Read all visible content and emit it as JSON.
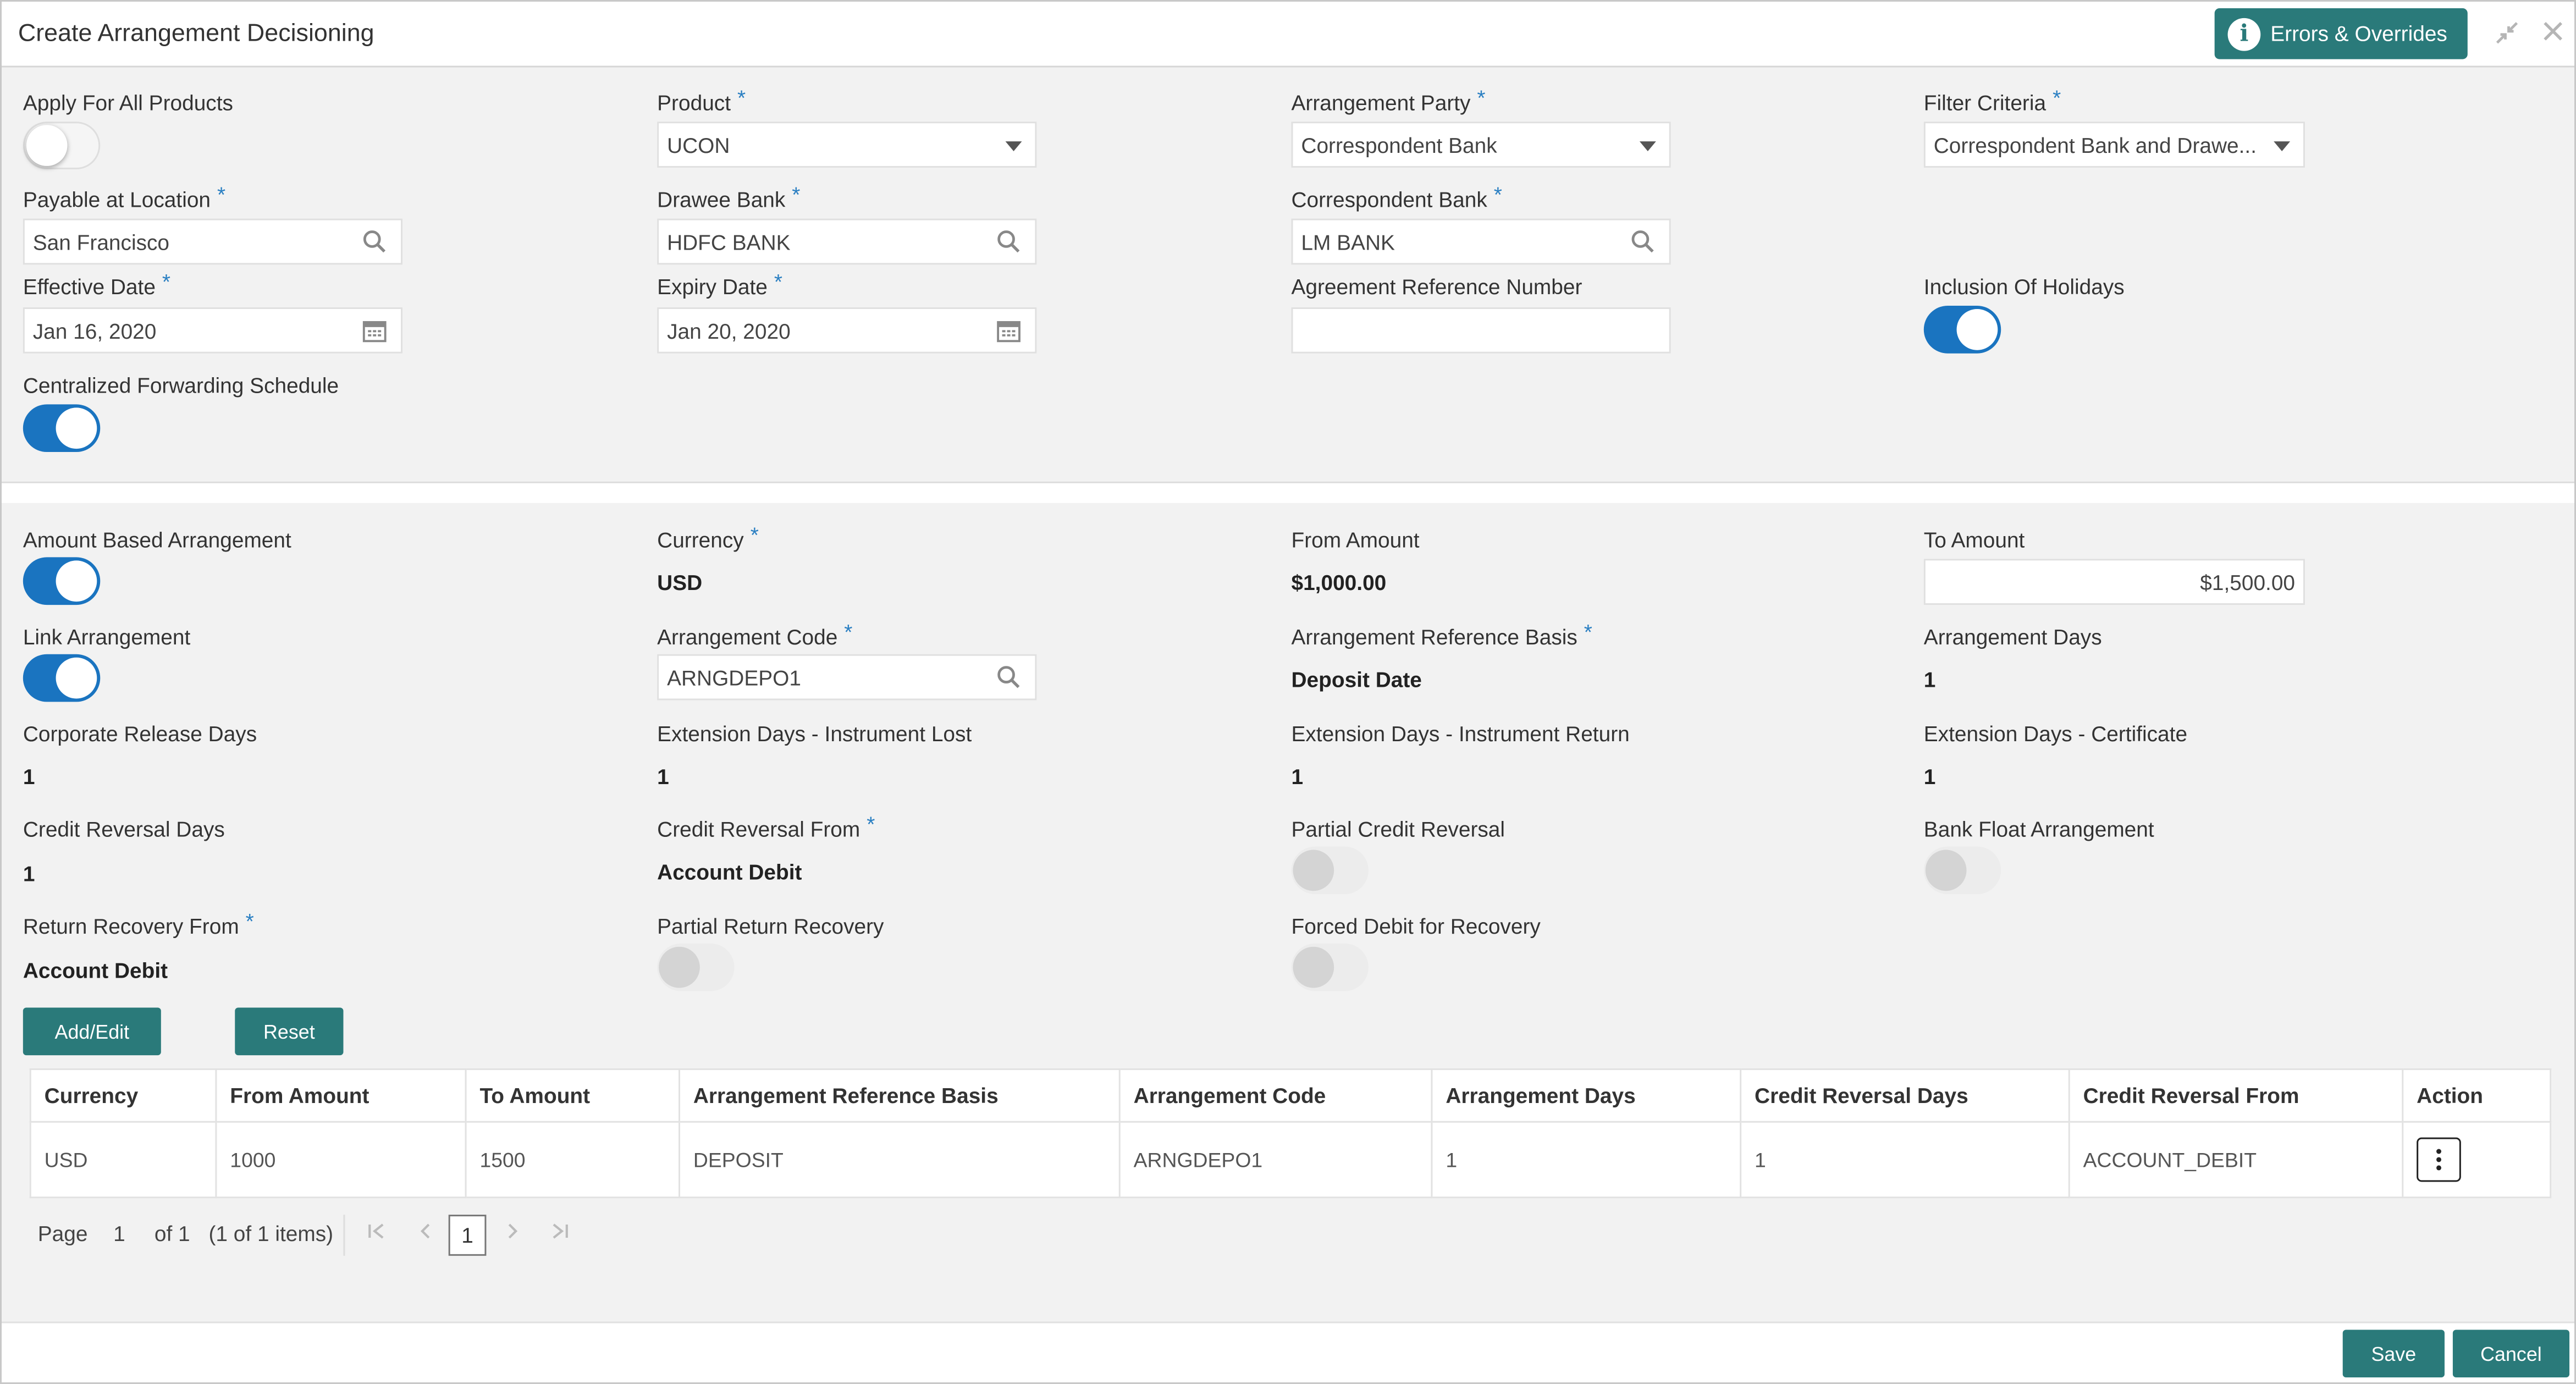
{
  "window": {
    "title": "Create Arrangement Decisioning",
    "errors_button": "Errors & Overrides",
    "info_icon": "i"
  },
  "section1": {
    "apply_all_label": "Apply For All Products",
    "apply_all_state": "off",
    "product_label": "Product",
    "product_value": "UCON",
    "arrangement_party_label": "Arrangement Party",
    "arrangement_party_value": "Correspondent Bank",
    "filter_criteria_label": "Filter Criteria",
    "filter_criteria_value": "Correspondent Bank and Drawe...",
    "payable_label": "Payable at Location",
    "payable_value": "San Francisco",
    "drawee_label": "Drawee Bank",
    "drawee_value": "HDFC BANK",
    "correspondent_label": "Correspondent Bank",
    "correspondent_value": "LM BANK",
    "effective_label": "Effective Date",
    "effective_value": "Jan 16, 2020",
    "expiry_label": "Expiry Date",
    "expiry_value": "Jan 20, 2020",
    "agreement_label": "Agreement Reference Number",
    "agreement_value": "",
    "holidays_label": "Inclusion Of Holidays",
    "holidays_state": "on",
    "cfs_label": "Centralized Forwarding Schedule",
    "cfs_state": "on"
  },
  "section2": {
    "amount_based_label": "Amount Based Arrangement",
    "currency_label": "Currency",
    "currency_value": "USD",
    "from_amount_label": "From Amount",
    "from_amount_value": "$1,000.00",
    "to_amount_label": "To Amount",
    "to_amount_value": "$1,500.00",
    "link_label": "Link Arrangement",
    "arr_code_label": "Arrangement Code",
    "arr_code_value": "ARNGDEPO1",
    "ref_basis_label": "Arrangement Reference Basis",
    "ref_basis_value": "Deposit Date",
    "arr_days_label": "Arrangement Days",
    "arr_days_value": "1",
    "corp_release_label": "Corporate Release Days",
    "corp_release_value": "1",
    "ext_lost_label": "Extension Days - Instrument Lost",
    "ext_lost_value": "1",
    "ext_return_label": "Extension Days - Instrument Return",
    "ext_return_value": "1",
    "ext_cert_label": "Extension Days - Certificate",
    "ext_cert_value": "1",
    "cr_rev_days_label": "Credit Reversal Days",
    "cr_rev_days_value": "1",
    "cr_rev_from_label": "Credit Reversal From",
    "cr_rev_from_value": "Account Debit",
    "partial_cr_label": "Partial Credit Reversal",
    "bank_float_label": "Bank Float Arrangement",
    "ret_recovery_label": "Return Recovery From",
    "ret_recovery_value": "Account Debit",
    "partial_ret_label": "Partial Return Recovery",
    "forced_debit_label": "Forced Debit for Recovery",
    "add_edit_button": "Add/Edit",
    "reset_button": "Reset"
  },
  "table": {
    "columns": [
      "Currency",
      "From Amount",
      "To Amount",
      "Arrangement Reference Basis",
      "Arrangement Code",
      "Arrangement Days",
      "Credit Reversal Days",
      "Credit Reversal From",
      "Action"
    ],
    "rows": [
      [
        "USD",
        "1000",
        "1500",
        "DEPOSIT",
        "ARNGDEPO1",
        "1",
        "1",
        "ACCOUNT_DEBIT"
      ]
    ]
  },
  "pager": {
    "page_label": "Page",
    "page_num": "1",
    "of_label": "of 1",
    "items_label": "(1 of 1 items)",
    "current": "1"
  },
  "footer": {
    "save": "Save",
    "cancel": "Cancel"
  },
  "colors": {
    "accent": "#2a7a7a",
    "toggle_on": "#1a74c0",
    "required_star": "#2a7fc2"
  }
}
